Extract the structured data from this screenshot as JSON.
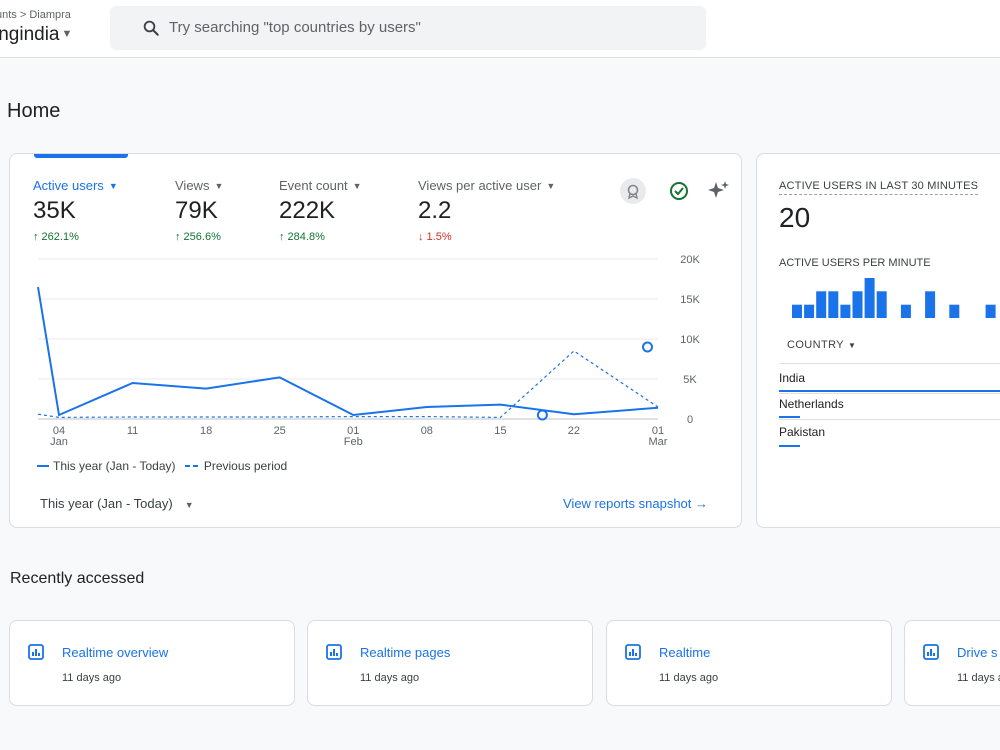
{
  "header": {
    "breadcrumb": "unts > Diampra",
    "property": "ingindia",
    "search_placeholder": "Try searching \"top countries by users\""
  },
  "page_title": "Home",
  "metrics": [
    {
      "label": "Active users",
      "value": "35K",
      "change": "↑ 262.1%",
      "direction": "up"
    },
    {
      "label": "Views",
      "value": "79K",
      "change": "↑ 256.6%",
      "direction": "up"
    },
    {
      "label": "Event count",
      "value": "222K",
      "change": "↑ 284.8%",
      "direction": "up"
    },
    {
      "label": "Views per active user",
      "value": "2.2",
      "change": "↓ 1.5%",
      "direction": "down"
    }
  ],
  "chart_data": {
    "type": "line",
    "x": [
      "Jan 02",
      "Jan 04",
      "Jan 11",
      "Jan 18",
      "Jan 25",
      "Feb 01",
      "Feb 08",
      "Feb 15",
      "Feb 22",
      "Mar 01"
    ],
    "x_tick_labels": [
      {
        "day": "04",
        "month": "Jan"
      },
      {
        "day": "11",
        "month": ""
      },
      {
        "day": "18",
        "month": ""
      },
      {
        "day": "25",
        "month": ""
      },
      {
        "day": "01",
        "month": "Feb"
      },
      {
        "day": "08",
        "month": ""
      },
      {
        "day": "15",
        "month": ""
      },
      {
        "day": "22",
        "month": ""
      },
      {
        "day": "01",
        "month": "Mar"
      }
    ],
    "y_ticks": [
      "20K",
      "15K",
      "10K",
      "5K",
      "0"
    ],
    "ylim": [
      0,
      20000
    ],
    "series": [
      {
        "name": "This year (Jan - Today)",
        "style": "solid",
        "points": [
          [
            "2024-01-02",
            16500
          ],
          [
            "2024-01-04",
            500
          ],
          [
            "2024-01-11",
            4500
          ],
          [
            "2024-01-18",
            3800
          ],
          [
            "2024-01-25",
            5200
          ],
          [
            "2024-02-01",
            500
          ],
          [
            "2024-02-08",
            1500
          ],
          [
            "2024-02-15",
            1800
          ],
          [
            "2024-02-22",
            600
          ],
          [
            "2024-03-01",
            1400
          ]
        ]
      },
      {
        "name": "Previous period",
        "style": "dashed",
        "points": [
          [
            "2024-01-02",
            600
          ],
          [
            "2024-01-04",
            200
          ],
          [
            "2024-01-11",
            250
          ],
          [
            "2024-01-18",
            250
          ],
          [
            "2024-01-25",
            250
          ],
          [
            "2024-02-01",
            300
          ],
          [
            "2024-02-08",
            300
          ],
          [
            "2024-02-15",
            200
          ],
          [
            "2024-02-22",
            8500
          ],
          [
            "2024-03-01",
            1500
          ]
        ]
      }
    ],
    "annotations": [
      {
        "date": "2024-02-19",
        "value": 500
      },
      {
        "date": "2024-02-29",
        "value": 9000
      }
    ],
    "legend_position": "bottom-left"
  },
  "legend": {
    "this_year": "This year (Jan - Today)",
    "previous": "Previous period"
  },
  "range_label": "This year (Jan - Today)",
  "view_link": "View reports snapshot",
  "realtime": {
    "title": "ACTIVE USERS IN LAST 30 MINUTES",
    "value": "20",
    "per_minute_label": "ACTIVE USERS PER MINUTE",
    "per_minute_values": [
      1,
      1,
      2,
      2,
      1,
      2,
      3,
      2,
      0,
      1,
      0,
      2,
      0,
      1,
      0,
      0,
      1
    ],
    "country_header": "COUNTRY",
    "countries": [
      {
        "name": "India",
        "share": 1.0
      },
      {
        "name": "Netherlands",
        "share": 0.09
      },
      {
        "name": "Pakistan",
        "share": 0.09
      }
    ]
  },
  "recently_accessed": {
    "title": "Recently accessed",
    "items": [
      {
        "title": "Realtime overview",
        "time": "11 days ago"
      },
      {
        "title": "Realtime pages",
        "time": "11 days ago"
      },
      {
        "title": "Realtime",
        "time": "11 days ago"
      },
      {
        "title": "Drive s",
        "time": "11 days a"
      }
    ]
  },
  "colors": {
    "accent": "#1a73e8",
    "positive": "#137333",
    "negative": "#d93025"
  }
}
